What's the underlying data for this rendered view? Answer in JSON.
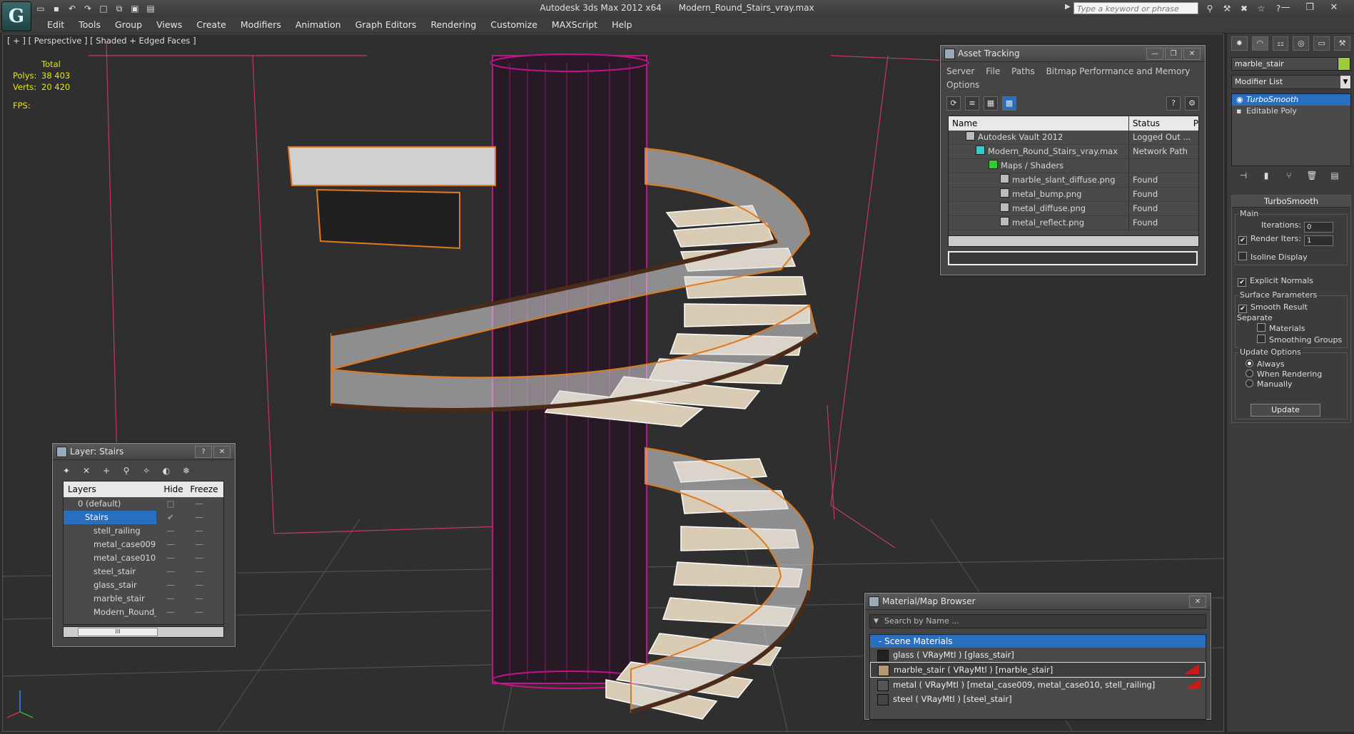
{
  "title_bar": {
    "app_name": "Autodesk 3ds Max  2012 x64",
    "file_name": "Modern_Round_Stairs_vray.max",
    "search_placeholder": "Type a keyword or phrase"
  },
  "menu": [
    "Edit",
    "Tools",
    "Group",
    "Views",
    "Create",
    "Modifiers",
    "Animation",
    "Graph Editors",
    "Rendering",
    "Customize",
    "MAXScript",
    "Help"
  ],
  "viewport": {
    "label": "[ + ] [ Perspective ] [ Shaded + Edged Faces ]",
    "stats": {
      "total_label": "Total",
      "polys_label": "Polys:",
      "polys_value": "38 403",
      "verts_label": "Verts:",
      "verts_value": "20 420",
      "fps_label": "FPS:"
    },
    "colors": {
      "wire_magenta": "#c0148c",
      "wire_orange": "#e07a1c",
      "grid_red": "#c63a5a"
    }
  },
  "asset_tracking": {
    "title": "Asset Tracking",
    "menu": [
      "Server",
      "File",
      "Paths",
      "Bitmap Performance and Memory",
      "Options"
    ],
    "columns": {
      "name": "Name",
      "status": "Status",
      "extra": "P"
    },
    "rows": [
      {
        "name": "Autodesk Vault 2012",
        "status": "Logged Out ..."
      },
      {
        "name": "Modern_Round_Stairs_vray.max",
        "status": "Network Path"
      },
      {
        "name": "Maps / Shaders",
        "status": ""
      },
      {
        "name": "marble_slant_diffuse.png",
        "status": "Found"
      },
      {
        "name": "metal_bump.png",
        "status": "Found"
      },
      {
        "name": "metal_diffuse.png",
        "status": "Found"
      },
      {
        "name": "metal_reflect.png",
        "status": "Found"
      }
    ]
  },
  "layer_panel": {
    "title": "Layer: Stairs",
    "columns": {
      "layers": "Layers",
      "hide": "Hide",
      "freeze": "Freeze"
    },
    "rows": [
      {
        "name": "0 (default)"
      },
      {
        "name": "Stairs"
      },
      {
        "name": "stell_railing"
      },
      {
        "name": "metal_case009"
      },
      {
        "name": "metal_case010"
      },
      {
        "name": "steel_stair"
      },
      {
        "name": "glass_stair"
      },
      {
        "name": "marble_stair"
      },
      {
        "name": "Modern_Round_"
      }
    ],
    "scroll_thumb": "III",
    "toolbar_icons": [
      "layer-icon",
      "delete-icon",
      "add-icon",
      "select-icon",
      "highlight-icon",
      "hide-icon",
      "freeze-icon"
    ]
  },
  "material_browser": {
    "title": "Material/Map Browser",
    "search_placeholder": "Search by Name ...",
    "group": "- Scene Materials",
    "items": [
      {
        "label": "glass  ( VRayMtl )  [glass_stair]"
      },
      {
        "label": "marble_stair  ( VRayMtl )  [marble_stair]"
      },
      {
        "label": "metal  ( VRayMtl )  [metal_case009, metal_case010, stell_railing]"
      },
      {
        "label": "steel  ( VRayMtl )  [steel_stair]"
      }
    ]
  },
  "command_panel": {
    "object_name": "marble_stair",
    "object_color": "#9ccc3c",
    "modifier_list": "Modifier List",
    "stack": [
      "TurboSmooth",
      "Editable Poly"
    ],
    "turbosmooth": {
      "title": "TurboSmooth",
      "main_label": "Main",
      "iterations_label": "Iterations:",
      "iterations_value": "0",
      "render_iters_label": "Render Iters:",
      "render_iters_value": "1",
      "isoline_label": "Isoline Display",
      "explicit_normals_label": "Explicit Normals",
      "surface_label": "Surface Parameters",
      "smooth_result_label": "Smooth Result",
      "separate_label": "Separate",
      "materials_label": "Materials",
      "smoothing_groups_label": "Smoothing Groups",
      "update_options_label": "Update Options",
      "always_label": "Always",
      "when_rendering_label": "When Rendering",
      "manually_label": "Manually",
      "update_button": "Update"
    }
  }
}
